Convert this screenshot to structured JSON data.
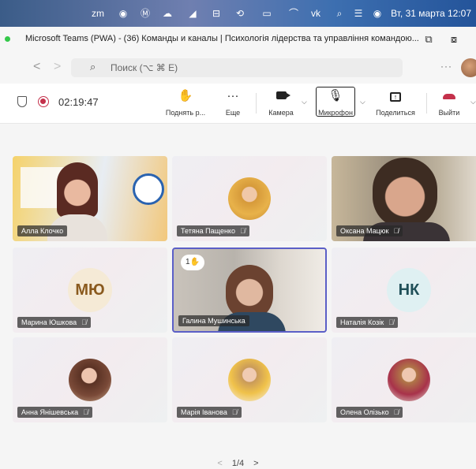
{
  "menubar": {
    "clock": "Вт, 31 марта  12:07",
    "icons": [
      "zm",
      "⬤",
      "M",
      "🄰",
      "◢",
      "⊟",
      "ⓘ",
      "▭",
      "◔",
      "vk",
      "⌕",
      "☰",
      "◉"
    ]
  },
  "window": {
    "title": "Microsoft Teams (PWA) - (36) Команды и каналы | Психологія лідерства та управління командою..."
  },
  "search": {
    "placeholder": "Поиск (⌥ ⌘ E)",
    "more": "···"
  },
  "toolbar": {
    "timer": "02:19:47",
    "raise_label": "Поднять р...",
    "more_label": "Еще",
    "camera_label": "Камера",
    "mic_label": "Микрофон",
    "share_label": "Поделиться",
    "leave_label": "Выйти",
    "colors": {
      "accent": "#5b5fc7",
      "leave": "#c4314b",
      "record": "#c4314b"
    }
  },
  "participants": [
    {
      "name": "Алла Клочко",
      "muted": false,
      "type": "video"
    },
    {
      "name": "Тетяна Пащенко",
      "muted": true,
      "type": "photo"
    },
    {
      "name": "Оксана Мацюк",
      "muted": true,
      "type": "video"
    },
    {
      "name": "Марина Юшкова",
      "muted": true,
      "type": "initials",
      "initials": "МЮ",
      "bg": "#f5ead6",
      "fg": "#8a5a1e"
    },
    {
      "name": "Галина Мушинська",
      "muted": false,
      "type": "video",
      "hand": "1",
      "speaking": true
    },
    {
      "name": "Наталія Козік",
      "muted": true,
      "type": "initials",
      "initials": "НК",
      "bg": "#dff0f2",
      "fg": "#1f4f58"
    },
    {
      "name": "Анна Янішевська",
      "muted": true,
      "type": "photo"
    },
    {
      "name": "Марія Іванова",
      "muted": true,
      "type": "photo"
    },
    {
      "name": "Олена Олізько",
      "muted": true,
      "type": "photo"
    }
  ],
  "pager": {
    "prev": "<",
    "label": "1/4",
    "next": ">"
  }
}
